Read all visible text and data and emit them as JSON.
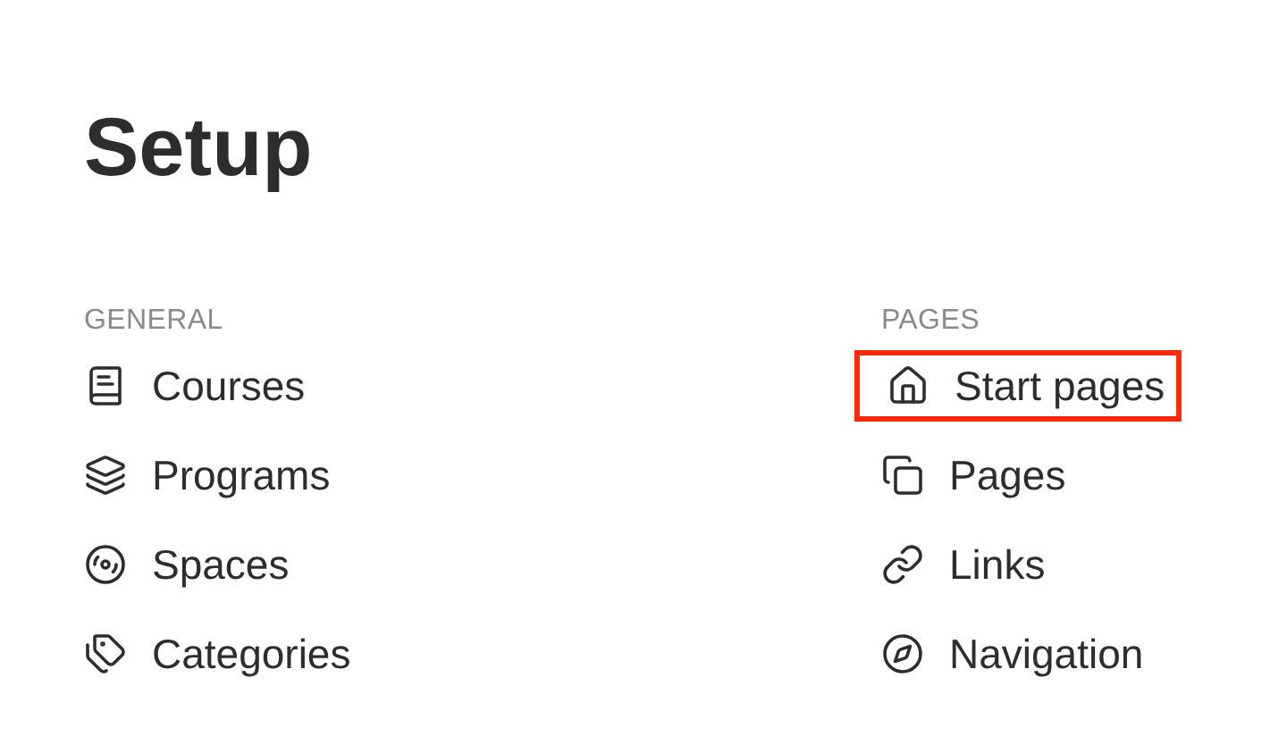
{
  "title": "Setup",
  "sections": [
    {
      "heading": "GENERAL",
      "items": [
        {
          "label": "Courses",
          "highlighted": false
        },
        {
          "label": "Programs",
          "highlighted": false
        },
        {
          "label": "Spaces",
          "highlighted": false
        },
        {
          "label": "Categories",
          "highlighted": false
        }
      ]
    },
    {
      "heading": "PAGES",
      "items": [
        {
          "label": "Start pages",
          "highlighted": true
        },
        {
          "label": "Pages",
          "highlighted": false
        },
        {
          "label": "Links",
          "highlighted": false
        },
        {
          "label": "Navigation",
          "highlighted": false
        }
      ]
    }
  ]
}
